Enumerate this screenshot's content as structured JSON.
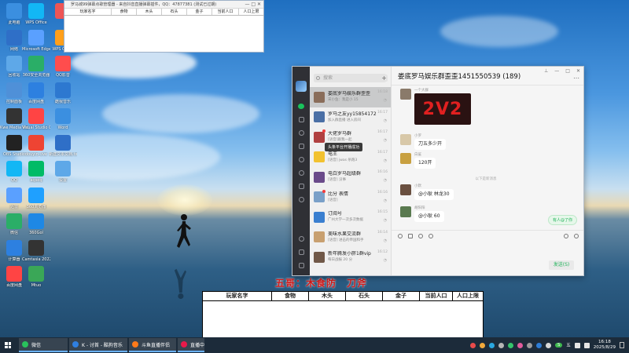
{
  "desktop": {
    "icons_col1": [
      "此电脑",
      "网络",
      "回收站",
      "控制面板",
      "Kwe Media Video Edi...",
      "OBS Studio",
      "QQ",
      "迅雷",
      "微信",
      "计算器",
      "百度网盘"
    ],
    "icons_col2": [
      "WPS Office",
      "Microsoft Edge",
      "360安全浏览器",
      "百度网盘",
      "Visual Studio Code",
      "douyin_live",
      "aqseq",
      "360浏览器",
      "360Gol",
      "Camtasia 2022",
      "Mtuo"
    ],
    "icons_col3": [
      "",
      "WPS Office",
      "QQ影音",
      "酷我音乐",
      "Word",
      "新建文本文档.txt",
      "设置"
    ]
  },
  "score_window": {
    "title": "罗马城99弹幕点歌管理器 - 来自抖音直播弹幕插件，QQ：47877381 (测试已过期)",
    "columns": [
      "玩家名字",
      "食物",
      "木头",
      "石头",
      "金子",
      "当前人口",
      "人口上限"
    ]
  },
  "overlay": {
    "title": "五哥：木食防　刀斧",
    "columns": [
      "玩家名字",
      "食物",
      "木头",
      "石头",
      "金子",
      "当前人口",
      "人口上限"
    ]
  },
  "qq": {
    "search_placeholder": "搜索",
    "conversations": [
      {
        "name": "娄底罗马娱乐群歪歪",
        "preview": "宋小鱼：我是小 15",
        "time": "16:18",
        "selected": true
      },
      {
        "name": "罗马之友yy15854172",
        "preview": "加入群直播 进入房间",
        "time": "16:17"
      },
      {
        "name": "大佬罗马群",
        "preview": "[语音]跟我一起",
        "time": "16:17"
      },
      {
        "name": "电王",
        "preview": "[语音] jwas 杀跑3",
        "time": "16:17"
      },
      {
        "name": "电白罗马超级群",
        "preview": "[语音] 没事",
        "time": "16:16"
      },
      {
        "name": "比分  表情",
        "preview": "[语音]",
        "time": "16:16"
      },
      {
        "name": "订阅号",
        "preview": "广州大学一次多次数据",
        "time": "16:15"
      },
      {
        "name": "美味水果交流群",
        "preview": "[语音] 进击的帝国和手",
        "time": "16:14"
      },
      {
        "name": "新年腾发小胖1群vip",
        "preview": "每日战报 20 分",
        "time": "16:12"
      }
    ],
    "tooltip": "头条平台开播成功",
    "chat": {
      "title": "娄底罗马娱乐群歪歪1451550539 (189)",
      "messages": [
        {
          "sender": "一个大群",
          "content": "2V2",
          "kind": "banner"
        },
        {
          "sender": "小罗",
          "content": "刀五多少开"
        },
        {
          "sender": "白鲨",
          "content": "120开"
        },
        {
          "sender": "小默",
          "content": "@小耿 林龙30"
        },
        {
          "sender": "胡阳阳",
          "content": "@小耿 60"
        }
      ],
      "system_note": "以下是新消息",
      "mention_badge": "有人@了你",
      "send_label": "发送(S)"
    }
  },
  "taskbar": {
    "items": [
      "微信",
      "K - 讨首 - 酷狗音乐",
      "斗鱼直播伴侣",
      "直播中的..."
    ],
    "tray_ime": "五",
    "time": "16:18",
    "date": "2025/8/29"
  },
  "colors": {
    "qq_green": "#19c35c",
    "overlay_red": "#d11a1a",
    "taskbar": "#1c2b3a"
  }
}
